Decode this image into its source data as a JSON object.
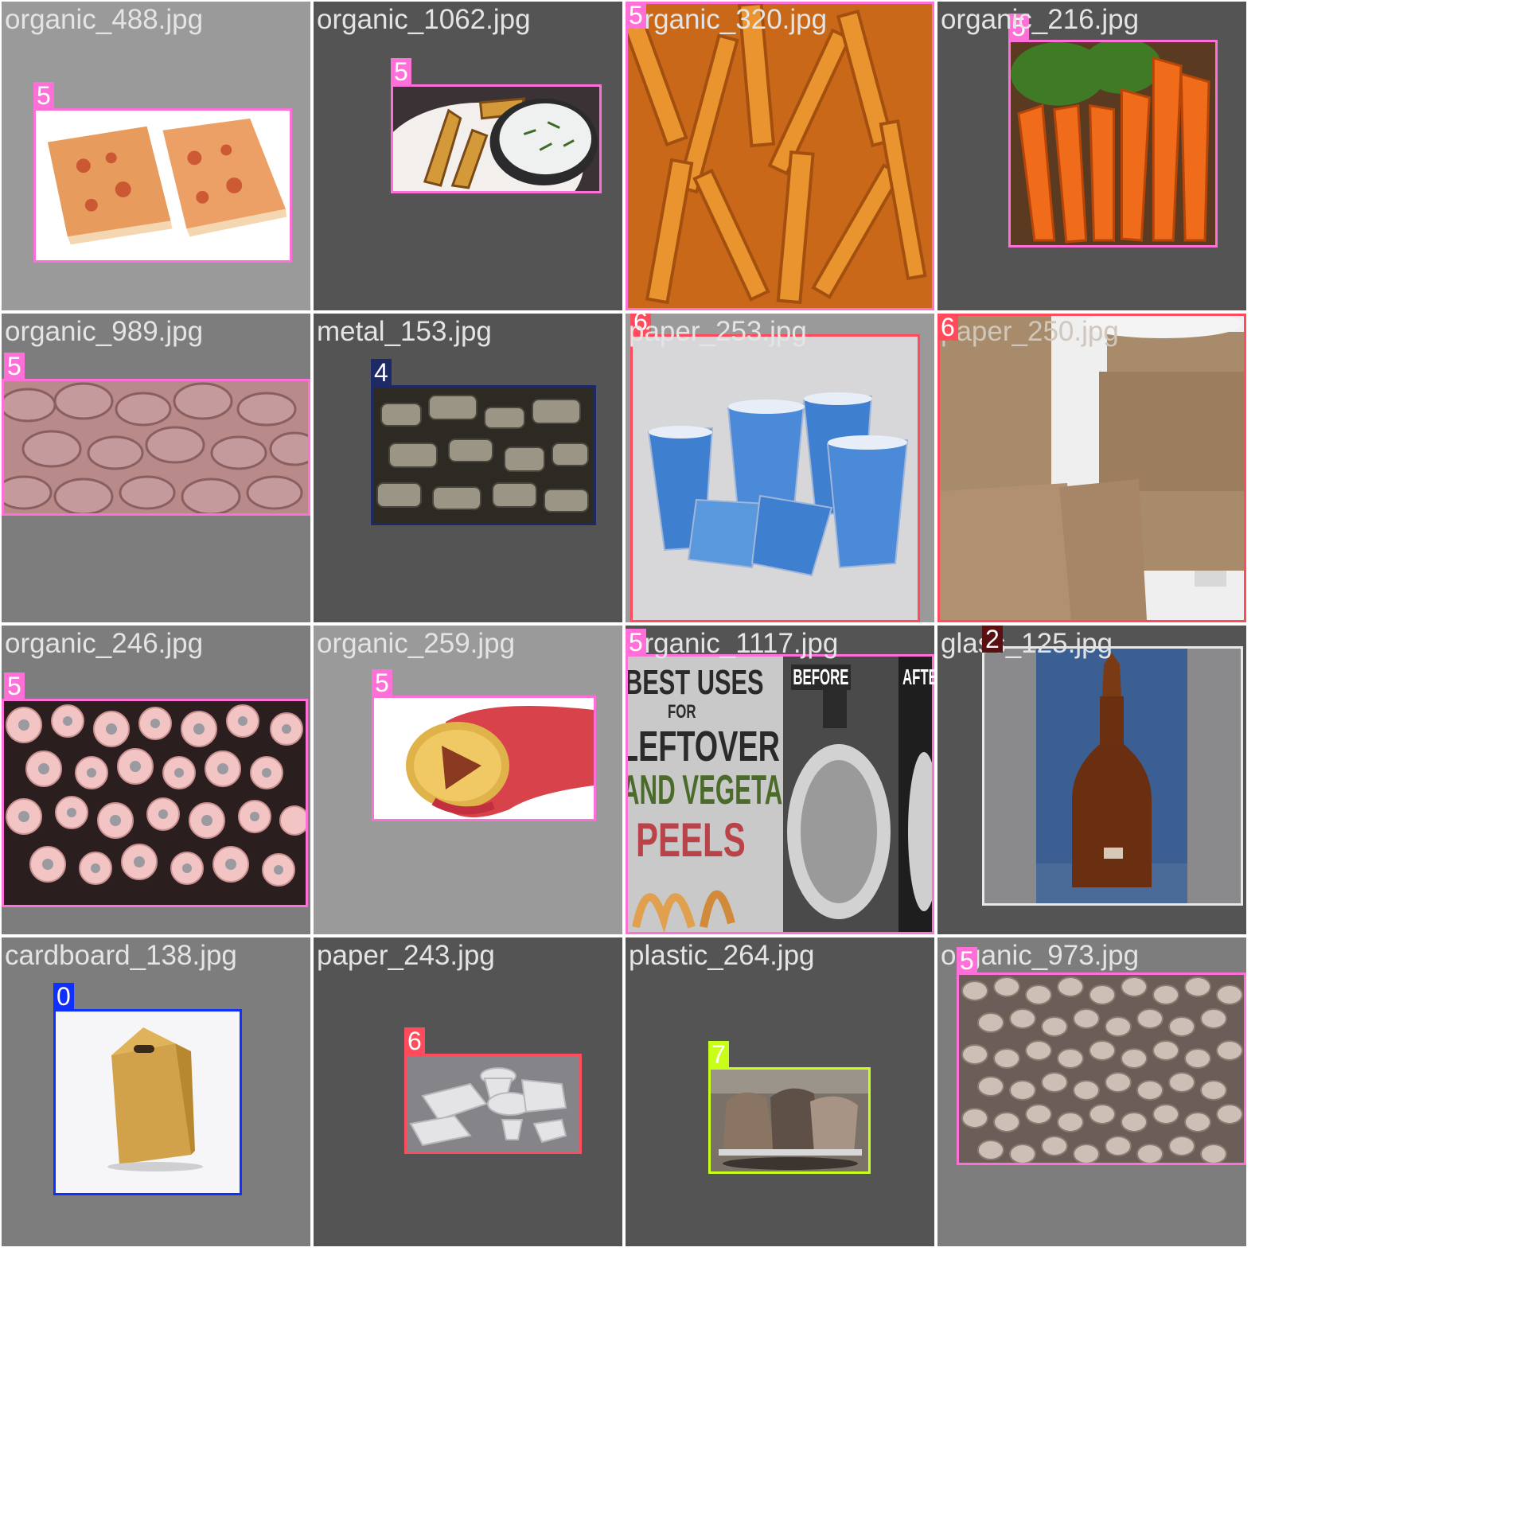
{
  "tiles": [
    {
      "file": "organic_488.jpg",
      "label": "5",
      "kind": "organic",
      "scene": "toast-slices"
    },
    {
      "file": "organic_1062.jpg",
      "label": "5",
      "kind": "organic",
      "scene": "potato-wedges-dip"
    },
    {
      "file": "organic_320.jpg",
      "label": "5",
      "kind": "organic",
      "scene": "sweet-potato-fries"
    },
    {
      "file": "organic_216.jpg",
      "label": "5",
      "kind": "organic",
      "scene": "carrot-bunch"
    },
    {
      "file": "organic_989.jpg",
      "label": "5",
      "kind": "organic",
      "scene": "kidney-beans"
    },
    {
      "file": "metal_153.jpg",
      "label": "4",
      "kind": "metal",
      "scene": "scrap-metal-parts"
    },
    {
      "file": "paper_253.jpg",
      "label": "6",
      "kind": "paper",
      "scene": "blue-paper-cups"
    },
    {
      "file": "paper_250.jpg",
      "label": "6",
      "kind": "paper",
      "scene": "kraft-cup-sleeves"
    },
    {
      "file": "organic_246.jpg",
      "label": "5",
      "kind": "organic",
      "scene": "pink-carrot-ends"
    },
    {
      "file": "organic_259.jpg",
      "label": "5",
      "kind": "organic",
      "scene": "hand-holding-potato"
    },
    {
      "file": "organic_1117.jpg",
      "label": "5",
      "kind": "organic",
      "scene": "peels-kettle-poster"
    },
    {
      "file": "glass_125.jpg",
      "label": "2",
      "kind": "glass",
      "scene": "amber-dropper-bottle"
    },
    {
      "file": "cardboard_138.jpg",
      "label": "0",
      "kind": "cardboard",
      "scene": "kraft-gift-box"
    },
    {
      "file": "paper_243.jpg",
      "label": "6",
      "kind": "paper",
      "scene": "foam-food-containers"
    },
    {
      "file": "plastic_264.jpg",
      "label": "7",
      "kind": "plastic",
      "scene": "bagged-trash-cart"
    },
    {
      "file": "organic_973.jpg",
      "label": "5",
      "kind": "organic",
      "scene": "lentils"
    }
  ],
  "poster_text": {
    "line1": "BEST USES",
    "line2": "FOR",
    "line3": "LEFTOVER",
    "line4": "AND VEGETABLE",
    "line5": "PEELS",
    "before": "BEFORE",
    "after": "AFTER"
  },
  "colors": {
    "organic": "#ff6fd8",
    "paper": "#ff4b5c",
    "metal": "#1e2a66",
    "glass": "#e8e8e8",
    "cardboard": "#1030ff",
    "plastic": "#c8ff1a"
  }
}
